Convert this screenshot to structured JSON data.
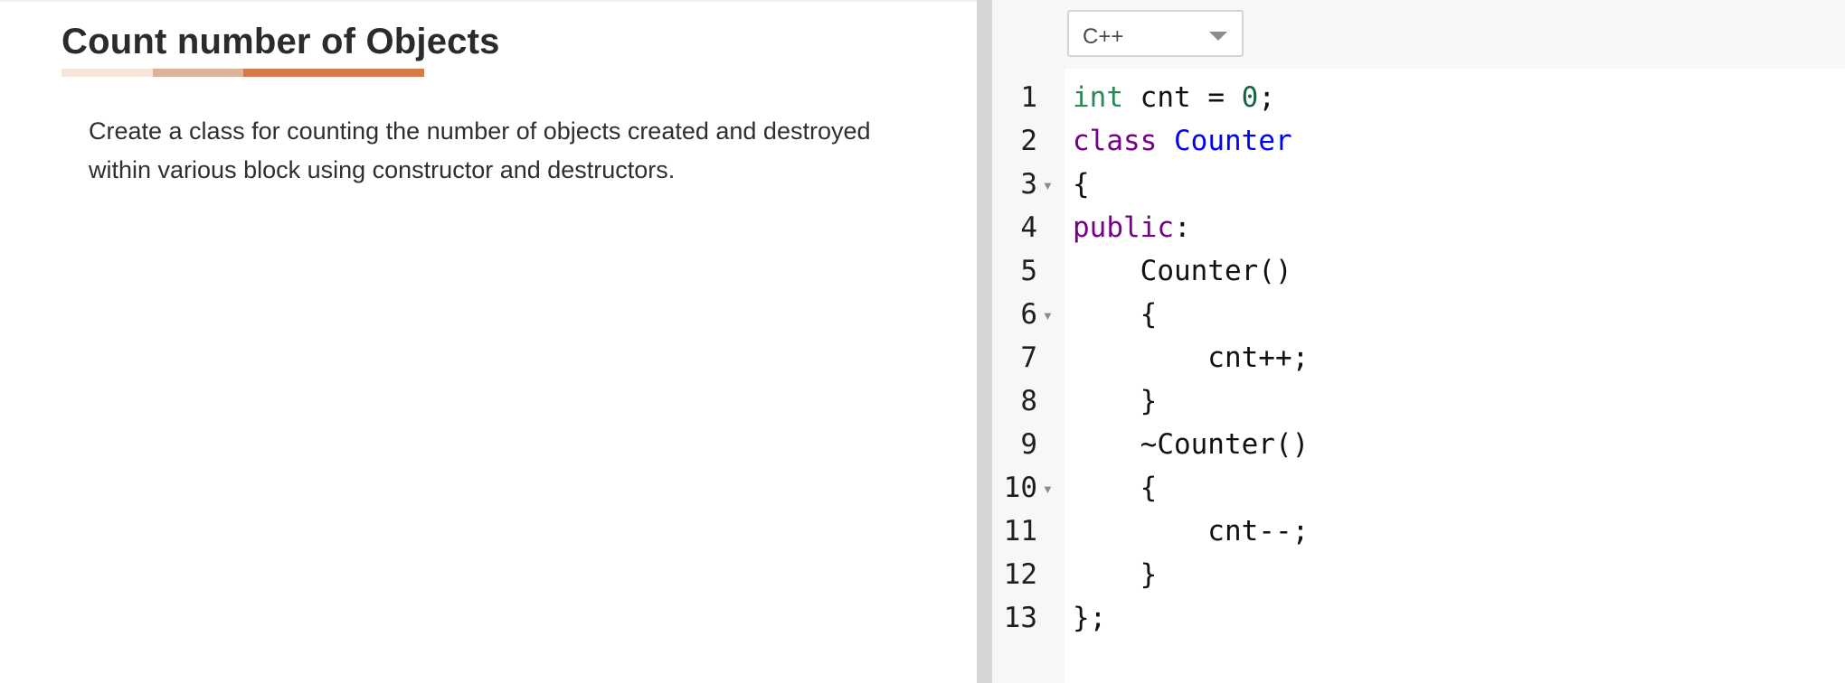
{
  "problem": {
    "title": "Count number of Objects",
    "description": "Create a class for counting the number of objects created and destroyed within various block using constructor and destructors."
  },
  "colors": {
    "underline": [
      "#f8e5da",
      "#dcb39a",
      "#d5784a"
    ],
    "keyword": "#770088",
    "type": "#2a8a56",
    "definition": "#0000ff",
    "number": "#116644"
  },
  "editor": {
    "language": "C++",
    "lines": [
      {
        "num": "1",
        "tokens": [
          {
            "t": "int",
            "c": "kw-type"
          },
          {
            "t": " cnt = "
          },
          {
            "t": "0",
            "c": "num"
          },
          {
            "t": ";"
          }
        ]
      },
      {
        "num": "2",
        "tokens": [
          {
            "t": "class",
            "c": "kw"
          },
          {
            "t": " "
          },
          {
            "t": "Counter",
            "c": "def"
          }
        ]
      },
      {
        "num": "3",
        "fold": true,
        "tokens": [
          {
            "t": "{"
          }
        ]
      },
      {
        "num": "4",
        "tokens": [
          {
            "t": "public",
            "c": "kw"
          },
          {
            "t": ":"
          }
        ]
      },
      {
        "num": "5",
        "tokens": [
          {
            "t": "    Counter()"
          }
        ]
      },
      {
        "num": "6",
        "fold": true,
        "tokens": [
          {
            "t": "    {"
          }
        ]
      },
      {
        "num": "7",
        "tokens": [
          {
            "t": "        cnt++;"
          }
        ]
      },
      {
        "num": "8",
        "tokens": [
          {
            "t": "    }"
          }
        ]
      },
      {
        "num": "9",
        "tokens": [
          {
            "t": "    ~Counter()"
          }
        ]
      },
      {
        "num": "10",
        "fold": true,
        "tokens": [
          {
            "t": "    {"
          }
        ]
      },
      {
        "num": "11",
        "tokens": [
          {
            "t": "        cnt--;"
          }
        ]
      },
      {
        "num": "12",
        "tokens": [
          {
            "t": "    }"
          }
        ]
      },
      {
        "num": "13",
        "tokens": [
          {
            "t": "};"
          }
        ]
      }
    ]
  }
}
